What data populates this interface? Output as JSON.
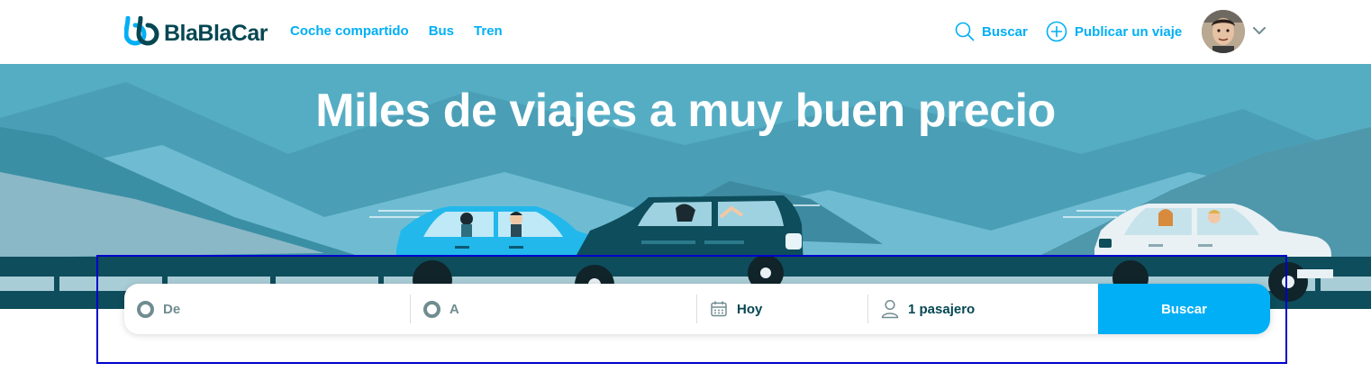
{
  "header": {
    "logo_text": "BlaBlaCar",
    "nav": [
      {
        "label": "Coche compartido"
      },
      {
        "label": "Bus"
      },
      {
        "label": "Tren"
      }
    ],
    "search_label": "Buscar",
    "publish_label": "Publicar un viaje"
  },
  "hero": {
    "title": "Miles de viajes a muy buen precio"
  },
  "search_form": {
    "from_placeholder": "De",
    "to_placeholder": "A",
    "date_value": "Hoy",
    "passengers_value": "1 pasajero",
    "submit_label": "Buscar"
  },
  "colors": {
    "brand": "#00aff5",
    "dark_text": "#054752",
    "muted": "#708c91"
  },
  "icons": [
    "logo-icon",
    "search-icon",
    "plus-circle-icon",
    "chevron-down-icon",
    "location-dot-icon",
    "calendar-icon",
    "person-icon"
  ]
}
